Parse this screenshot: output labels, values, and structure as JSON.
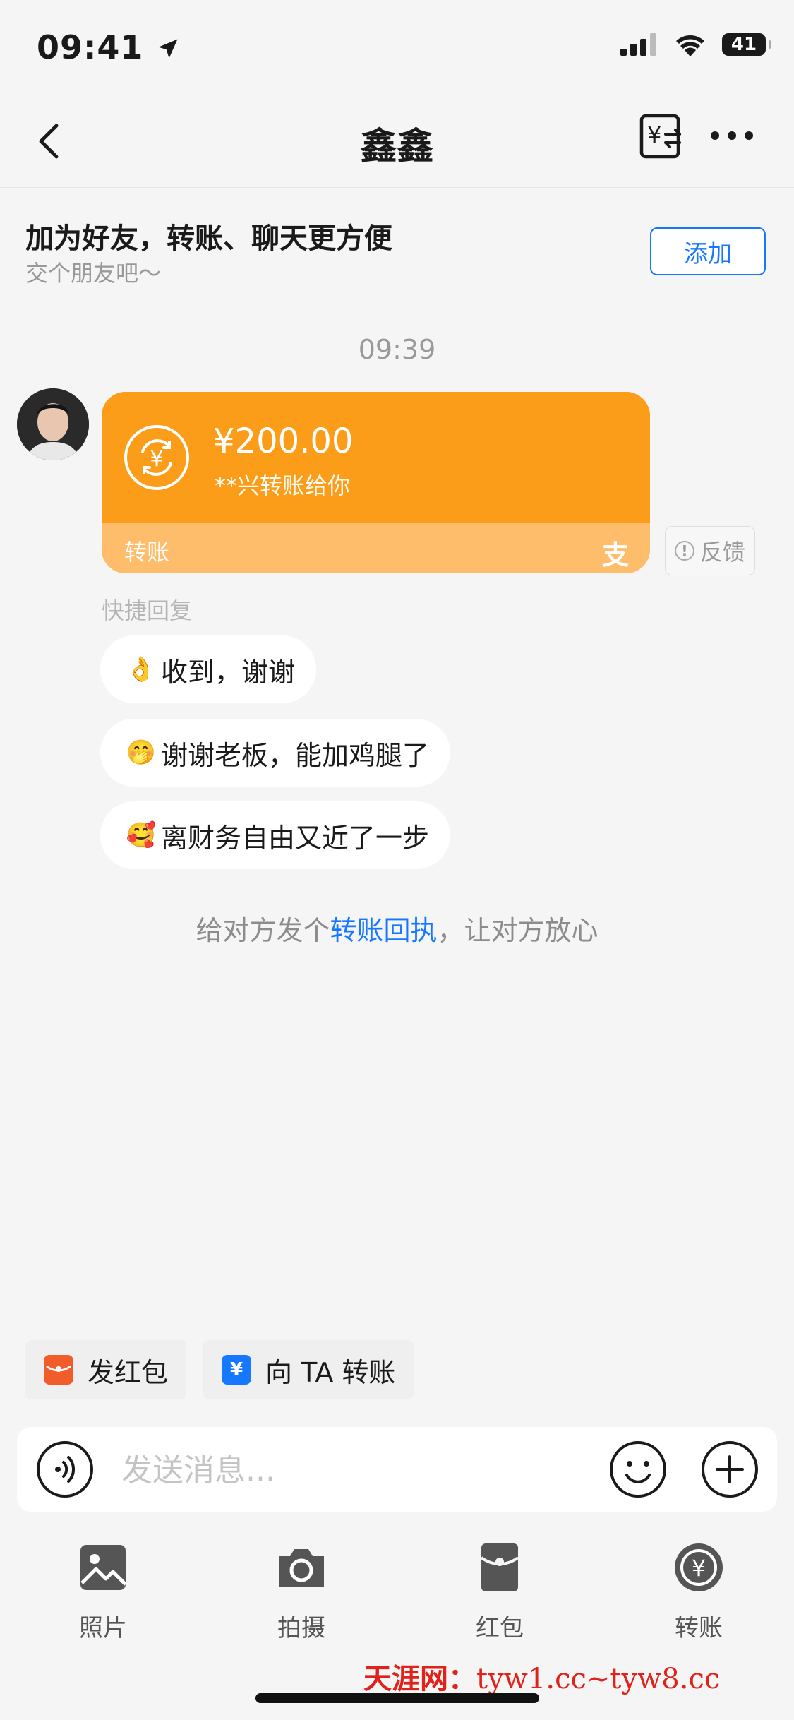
{
  "status": {
    "time": "09:41",
    "battery": "41"
  },
  "nav": {
    "title": "鑫鑫"
  },
  "banner": {
    "title": "加为好友，转账、聊天更方便",
    "subtitle": "交个朋友吧～",
    "add_label": "添加"
  },
  "chat": {
    "time": "09:39"
  },
  "transfer_card": {
    "amount": "¥200.00",
    "desc": "**兴转账给你",
    "label": "转账",
    "brand_glyph": "支"
  },
  "feedback": {
    "label": "反馈"
  },
  "quick_reply": {
    "title": "快捷回复",
    "items": [
      {
        "emoji": "👌",
        "text": "收到，谢谢"
      },
      {
        "emoji": "🤭",
        "text": "谢谢老板，能加鸡腿了"
      },
      {
        "emoji": "🥰",
        "text": "离财务自由又近了一步"
      }
    ]
  },
  "receipt": {
    "prefix": "给对方发个",
    "link": "转账回执",
    "suffix": "，让对方放心"
  },
  "shortcuts": {
    "red_packet": "发红包",
    "transfer": "向 TA 转账"
  },
  "input": {
    "placeholder": "发送消息..."
  },
  "tools": [
    {
      "label": "照片",
      "icon": "photo-icon"
    },
    {
      "label": "拍摄",
      "icon": "camera-icon"
    },
    {
      "label": "红包",
      "icon": "red-packet-icon"
    },
    {
      "label": "转账",
      "icon": "transfer-icon"
    }
  ],
  "watermark": {
    "site": "天涯网：",
    "url": "tyw1.cc~tyw8.cc"
  },
  "colors": {
    "accent": "#1677ff",
    "card": "#fc9d1a",
    "card_footer": "#fdbd6a",
    "red_packet": "#f25b2a"
  }
}
